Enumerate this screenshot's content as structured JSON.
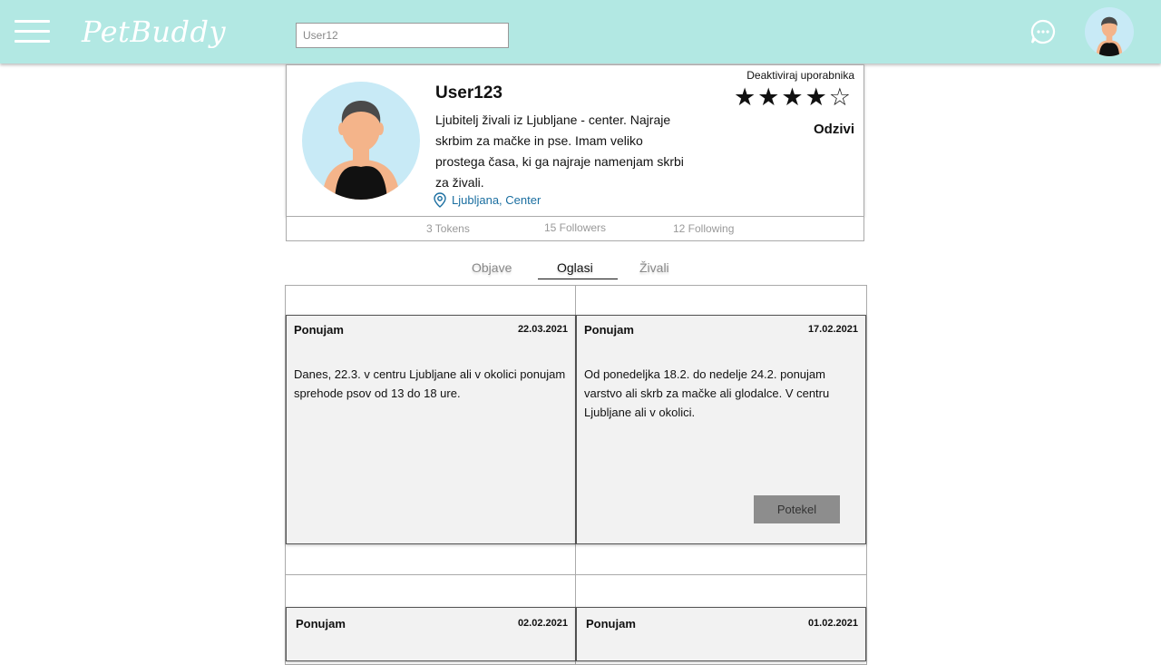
{
  "header": {
    "logo": "PetBuddy",
    "search_value": "User12",
    "icons": {
      "menu": "hamburger-menu-icon",
      "chat": "chat-bubble-icon"
    },
    "colors": {
      "bar": "#b2e8e3"
    }
  },
  "profile": {
    "username": "User123",
    "bio": "Ljubitelj živali iz Ljubljane - center. Najraje skrbim za mačke in pse. Imam veliko prostega časa, ki ga najraje namenjam skrbi za živali.",
    "location": "Ljubljana, Center",
    "deactivate_label": "Deaktiviraj uporabnika",
    "rating": 4,
    "rating_max": 5,
    "stars_display": "★★★★☆",
    "responses_label": "Odzivi"
  },
  "stats": {
    "tokens": "3 Tokens",
    "followers": "15 Followers",
    "following": "12 Following"
  },
  "tabs": [
    {
      "label": "Objave",
      "active": false
    },
    {
      "label": "Oglasi",
      "active": true
    },
    {
      "label": "Živali",
      "active": false
    }
  ],
  "ads": [
    {
      "type": "Ponujam",
      "date": "22.03.2021",
      "description": "Danes, 22.3. v centru Ljubljane ali v okolici ponujam sprehode psov od 13 do 18 ure.",
      "button": ""
    },
    {
      "type": "Ponujam",
      "date": "17.02.2021",
      "description": "Od ponedeljka 18.2. do nedelje 24.2. ponujam varstvo ali skrb za mačke ali glodalce. V centru Ljubljane ali v okolici.",
      "button": "Potekel"
    },
    {
      "type": "Ponujam",
      "date": "02.02.2021",
      "description": "",
      "button": ""
    },
    {
      "type": "Ponujam",
      "date": "01.02.2021",
      "description": "",
      "button": ""
    }
  ]
}
